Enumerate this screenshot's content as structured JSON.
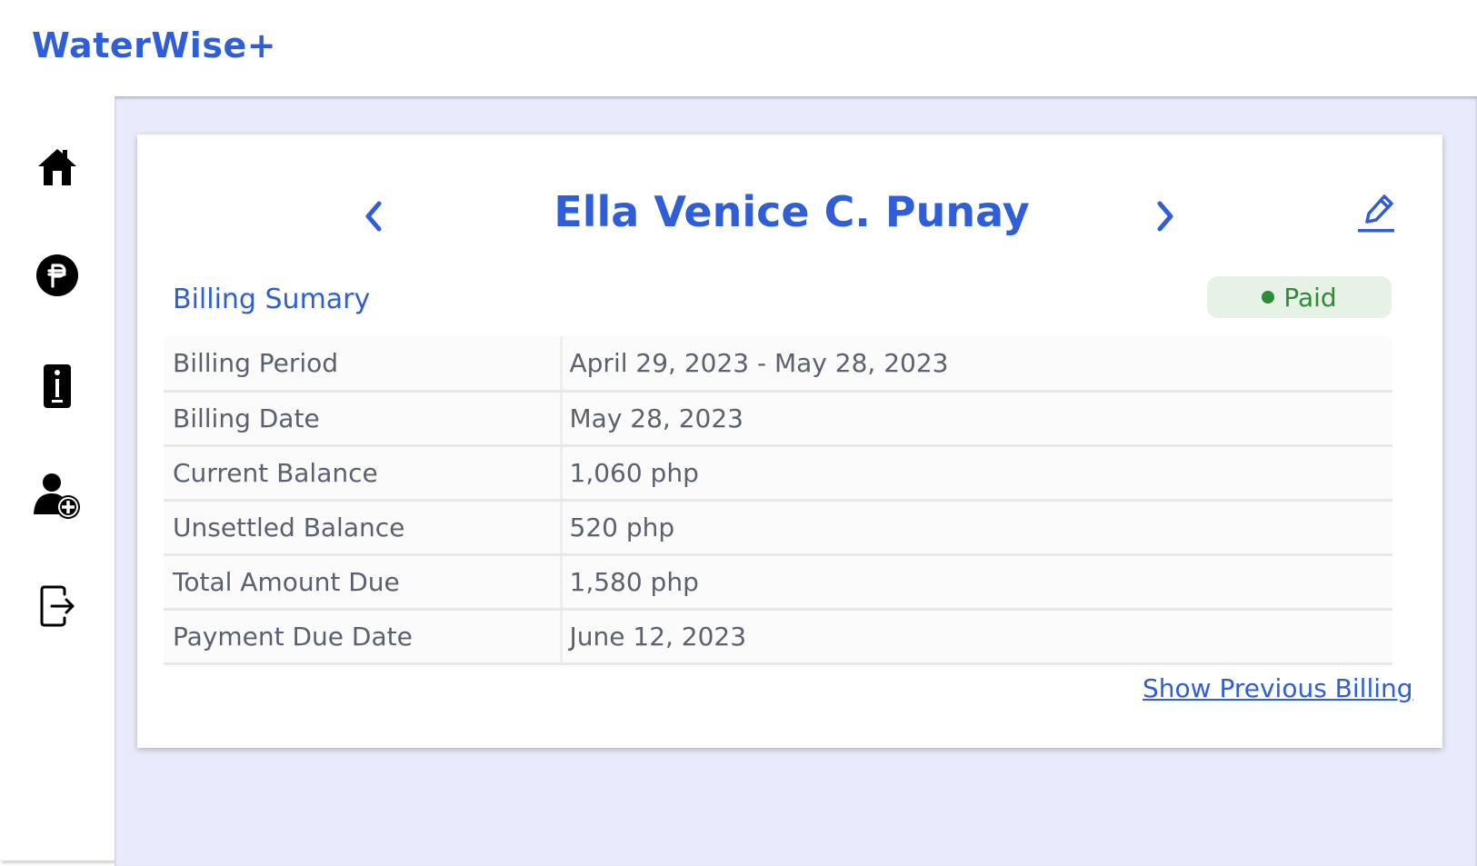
{
  "app": {
    "brand": "WaterWise+"
  },
  "sidebar": {
    "items": [
      {
        "name": "home",
        "icon": "home-icon"
      },
      {
        "name": "billing",
        "icon": "peso-coin-icon"
      },
      {
        "name": "info",
        "icon": "info-icon"
      },
      {
        "name": "add-user",
        "icon": "add-user-icon"
      },
      {
        "name": "logout",
        "icon": "logout-icon"
      }
    ]
  },
  "customer": {
    "name": "Ella Venice C. Punay"
  },
  "billing": {
    "section_title": "Billing Sumary",
    "status": "Paid",
    "rows": [
      {
        "label": "Billing Period",
        "value": "April 29, 2023 - May 28, 2023"
      },
      {
        "label": "Billing Date",
        "value": "May 28, 2023"
      },
      {
        "label": "Current Balance",
        "value": "1,060 php"
      },
      {
        "label": "Unsettled Balance",
        "value": "520 php"
      },
      {
        "label": "Total Amount Due",
        "value": "1,580 php"
      },
      {
        "label": "Payment Due Date",
        "value": "June 12, 2023"
      }
    ],
    "previous_link": "Show Previous Billing"
  },
  "colors": {
    "accent": "#2f5ed6",
    "paid": "#2e8b37",
    "paid_bg": "#e7f2e6",
    "background": "#e8ebfb"
  }
}
